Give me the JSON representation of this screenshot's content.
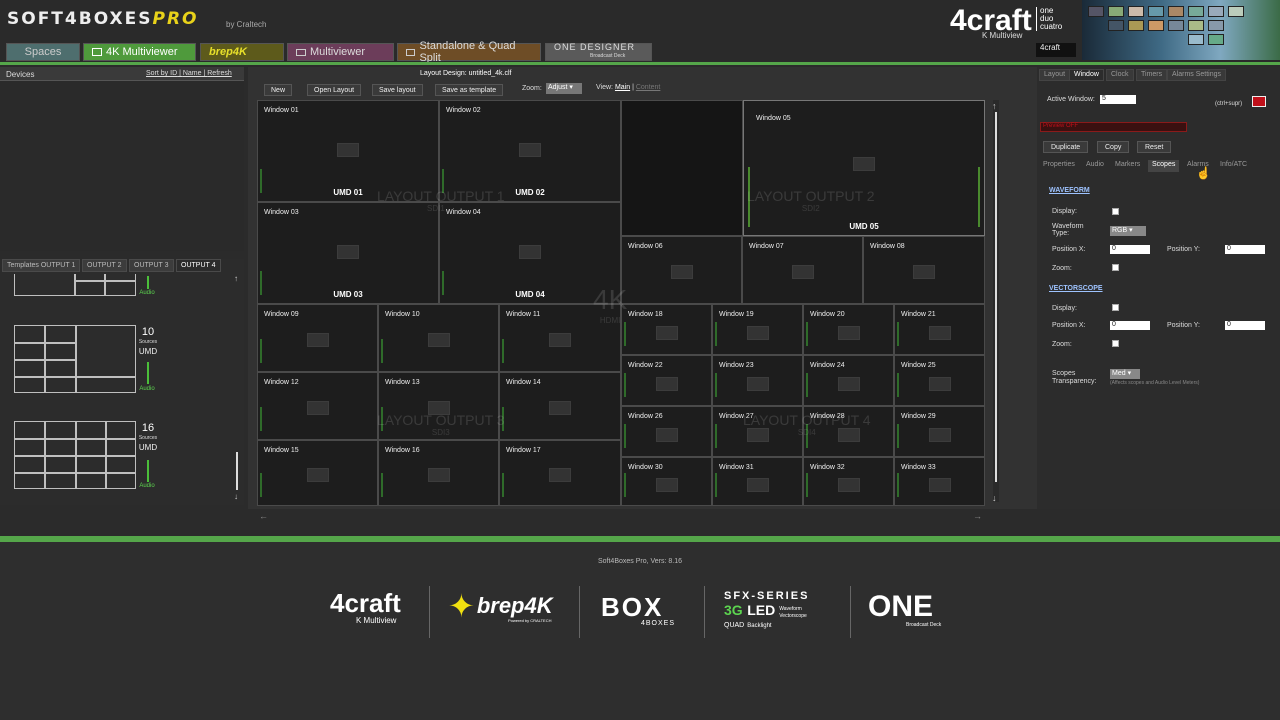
{
  "header": {
    "brand": "SOFT4BOXES",
    "brand_pro": "PRO",
    "byline": "by Craltech",
    "nav_tabs": [
      "Spaces",
      "4K Multiviewer",
      "brep4K",
      "Multiviewer",
      "Standalone & Quad Split",
      "ONE DESIGNER"
    ],
    "one_designer_sub": "Broadcast Deck",
    "logo": {
      "big": "4craft",
      "sub": "K Multiview",
      "odq": [
        "one",
        "duo",
        "cuatro"
      ]
    },
    "small_logo": "4craft"
  },
  "devices": {
    "title": "Devices",
    "sort_by": "Sort by ID",
    "name": "Name",
    "refresh": "Refresh"
  },
  "output_tabs": [
    "Templates OUTPUT 1",
    "OUTPUT 2",
    "OUTPUT 3",
    "OUTPUT 4"
  ],
  "templates": [
    {
      "sources": "10",
      "sources_label": "Sources",
      "umd": "UMD",
      "audio": "Audio"
    },
    {
      "sources": "16",
      "sources_label": "Sources",
      "umd": "UMD",
      "audio": "Audio"
    }
  ],
  "top_template_audio": "Audio",
  "toolbar": {
    "layout_design": "Layout Design: untitled_4k.clf",
    "new": "New",
    "open": "Open Layout",
    "save": "Save layout",
    "save_tmpl": "Save as template",
    "zoom_label": "Zoom:",
    "zoom_value": "Adjust",
    "view_label": "View:",
    "view_main": "Main",
    "view_content": "Content"
  },
  "windows": {
    "w01": "Window 01",
    "w02": "Window 02",
    "w03": "Window 03",
    "w04": "Window 04",
    "w05": "Window 05",
    "w06": "Window 06",
    "w07": "Window 07",
    "w08": "Window 08",
    "w09": "Window 09",
    "w10": "Window 10",
    "w11": "Window 11",
    "w12": "Window 12",
    "w13": "Window 13",
    "w14": "Window 14",
    "w15": "Window 15",
    "w16": "Window 16",
    "w17": "Window 17",
    "w18": "Window 18",
    "w19": "Window 19",
    "w20": "Window 20",
    "w21": "Window 21",
    "w22": "Window 22",
    "w23": "Window 23",
    "w24": "Window 24",
    "w25": "Window 25",
    "w26": "Window 26",
    "w27": "Window 27",
    "w28": "Window 28",
    "w29": "Window 29",
    "w30": "Window 30",
    "w31": "Window 31",
    "w32": "Window 32",
    "w33": "Window 33"
  },
  "umds": {
    "u01": "UMD 01",
    "u02": "UMD 02",
    "u03": "UMD 03",
    "u04": "UMD 04",
    "u05": "UMD 05"
  },
  "watermarks": {
    "o1": "LAYOUT OUTPUT 1",
    "o1s": "SDI1",
    "o2": "LAYOUT OUTPUT 2",
    "o2s": "SDI2",
    "o3": "LAYOUT OUTPUT 3",
    "o3s": "SDI3",
    "o4": "LAYOUT OUTPUT 4",
    "o4s": "SDI4",
    "k4": "4K",
    "k4s": "HDMI"
  },
  "right": {
    "tabs": [
      "Layout",
      "Window",
      "Clock",
      "Timers",
      "Alarms Settings"
    ],
    "active_window_label": "Active Window:",
    "active_window_value": "5",
    "ctrl": "(ctrl+supr)",
    "preview": "Preview OFF",
    "buttons": [
      "Duplicate",
      "Copy",
      "Reset"
    ],
    "subtabs": [
      "Properties",
      "Audio",
      "Markers",
      "Scopes",
      "Alarms",
      "Info/ATC"
    ],
    "waveform": {
      "title": "WAVEFORM",
      "display": "Display:",
      "type_label": "Waveform Type:",
      "type_value": "RGB",
      "posx": "Position X:",
      "posx_val": "0",
      "posy": "Position Y:",
      "posy_val": "0",
      "zoom": "Zoom:"
    },
    "vectorscope": {
      "title": "VECTORSCOPE",
      "display": "Display:",
      "posx": "Position X:",
      "posx_val": "0",
      "posy": "Position Y:",
      "posy_val": "0",
      "zoom": "Zoom:"
    },
    "transp_label": "Scopes Transparency:",
    "transp_value": "Med",
    "transp_note": "(Affects scopes and Audio Level Meters)"
  },
  "footer": {
    "version": "Soft4Boxes Pro, Vers: 8.16",
    "logo1": "4craft",
    "logo1_sub": "K Multiview",
    "logo2": "brep4K",
    "logo2_sub": "Powered by CRALTECH",
    "logo3": "BOX",
    "logo3_sub": "4BOXES",
    "logo4_top": "SFX-SERIES",
    "logo4_3g": "3G",
    "logo4_led": "LED",
    "logo4_quad": "QUAD",
    "logo4_bl": "Backlight",
    "logo4_wf": "Waveform",
    "logo4_vs": "Vectorscope",
    "logo5": "ONE",
    "logo5_sub": "Broadcast Deck"
  },
  "colors": {
    "accent_green": "#55a64a",
    "preview_red": "#c0101a"
  }
}
